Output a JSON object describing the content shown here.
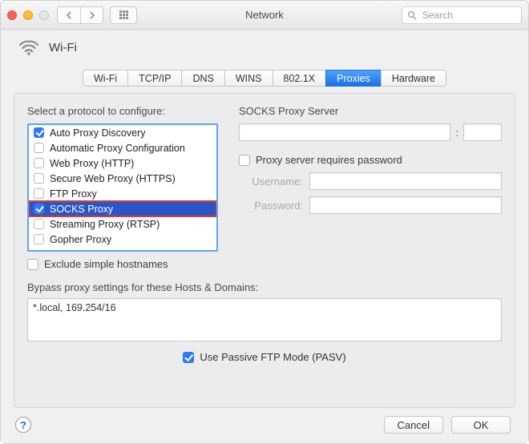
{
  "window": {
    "title": "Network"
  },
  "toolbar": {
    "search_placeholder": "Search"
  },
  "header": {
    "interface": "Wi-Fi"
  },
  "tabs": [
    "Wi-Fi",
    "TCP/IP",
    "DNS",
    "WINS",
    "802.1X",
    "Proxies",
    "Hardware"
  ],
  "active_tab": "Proxies",
  "left": {
    "label": "Select a protocol to configure:",
    "items": [
      {
        "label": "Auto Proxy Discovery",
        "checked": true,
        "selected": false
      },
      {
        "label": "Automatic Proxy Configuration",
        "checked": false,
        "selected": false
      },
      {
        "label": "Web Proxy (HTTP)",
        "checked": false,
        "selected": false
      },
      {
        "label": "Secure Web Proxy (HTTPS)",
        "checked": false,
        "selected": false
      },
      {
        "label": "FTP Proxy",
        "checked": false,
        "selected": false
      },
      {
        "label": "SOCKS Proxy",
        "checked": true,
        "selected": true
      },
      {
        "label": "Streaming Proxy (RTSP)",
        "checked": false,
        "selected": false
      },
      {
        "label": "Gopher Proxy",
        "checked": false,
        "selected": false
      }
    ],
    "exclude_label": "Exclude simple hostnames",
    "exclude_checked": false
  },
  "right": {
    "server_label": "SOCKS Proxy Server",
    "host": "",
    "port": "",
    "requires_pw_label": "Proxy server requires password",
    "requires_pw_checked": false,
    "username_label": "Username:",
    "username": "",
    "password_label": "Password:",
    "password": ""
  },
  "bypass": {
    "label": "Bypass proxy settings for these Hosts & Domains:",
    "value": "*.local, 169.254/16"
  },
  "pasv": {
    "label": "Use Passive FTP Mode (PASV)",
    "checked": true
  },
  "footer": {
    "cancel": "Cancel",
    "ok": "OK"
  }
}
